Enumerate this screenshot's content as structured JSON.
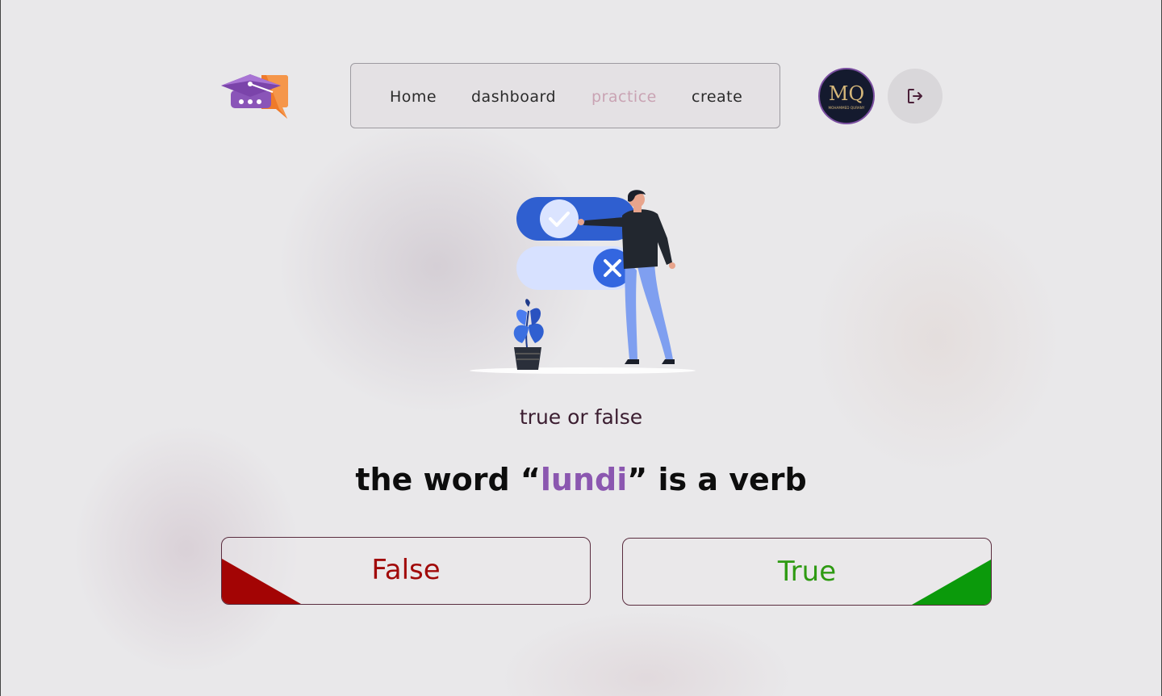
{
  "nav": {
    "items": [
      {
        "label": "Home"
      },
      {
        "label": "dashboard"
      },
      {
        "label": "practice"
      },
      {
        "label": "create"
      }
    ],
    "active": "practice"
  },
  "avatar": {
    "initials": "MQ",
    "name": "MOHAMMED QURANY"
  },
  "icons": {
    "logo": "graduation-cap-chat-icon",
    "logout": "logout-icon",
    "check": "check-icon",
    "cross": "close-icon"
  },
  "quiz": {
    "type_label": "true or false",
    "question_prefix": "the word “",
    "question_word": "lundi",
    "question_suffix": "” is a verb",
    "false_label": "False",
    "true_label": "True"
  },
  "colors": {
    "accent_purple": "#8b57b0",
    "false_red": "#a10a0a",
    "true_green": "#0b9a0b",
    "nav_active": "#c9a3b3"
  }
}
